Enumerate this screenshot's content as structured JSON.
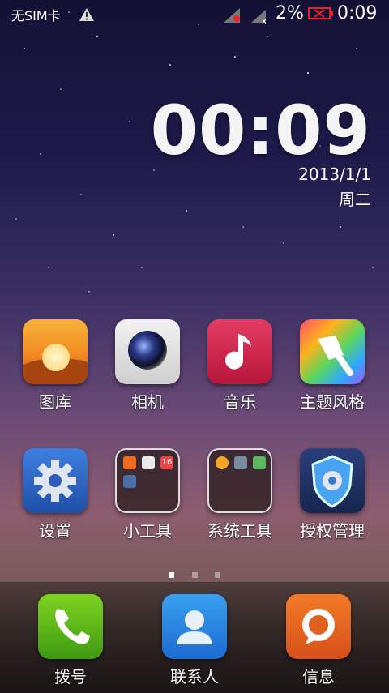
{
  "status_bar": {
    "sim_text": "无SIM卡",
    "battery_percent": "2%",
    "time": "0:09"
  },
  "clock": {
    "time": "00:09",
    "date": "2013/1/1",
    "weekday": "周二"
  },
  "apps": {
    "row1": [
      {
        "label": "图库",
        "icon": "gallery-icon"
      },
      {
        "label": "相机",
        "icon": "camera-icon"
      },
      {
        "label": "音乐",
        "icon": "music-icon"
      },
      {
        "label": "主题风格",
        "icon": "theme-icon"
      }
    ],
    "row2": [
      {
        "label": "设置",
        "icon": "settings-icon"
      },
      {
        "label": "小工具",
        "icon": "widgets-folder-icon"
      },
      {
        "label": "系统工具",
        "icon": "system-tools-folder-icon"
      },
      {
        "label": "授权管理",
        "icon": "permission-manager-icon"
      }
    ]
  },
  "widgets_folder": {
    "calendar_day": "16"
  },
  "pager": {
    "pages": 3,
    "active_index": 0
  },
  "dock": [
    {
      "label": "拨号",
      "icon": "phone-icon"
    },
    {
      "label": "联系人",
      "icon": "contacts-icon"
    },
    {
      "label": "信息",
      "icon": "messages-icon"
    }
  ]
}
